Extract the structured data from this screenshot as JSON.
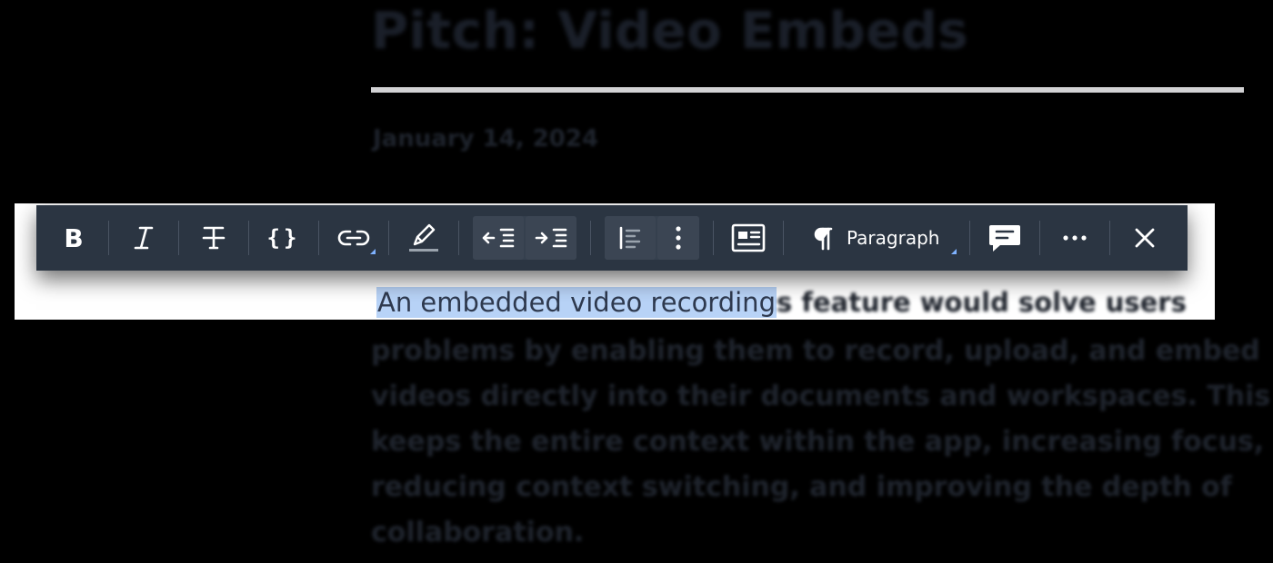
{
  "document": {
    "title": "Pitch: Video Embeds",
    "date": "January 14, 2024",
    "paragraph_line1_selected": "An embedded video recording",
    "paragraph_line1_rest": "s feature would solve users",
    "paragraph_lines": [
      "problems by enabling them to record, upload, and embed",
      "videos directly into their documents and workspaces. This",
      "keeps the entire context within the app, increasing focus,",
      "reducing context switching, and improving the depth of",
      "collaboration."
    ]
  },
  "toolbar": {
    "paragraph_label": "Paragraph",
    "buttons": [
      {
        "name": "bold",
        "icon": "bold-icon"
      },
      {
        "name": "italic",
        "icon": "italic-icon"
      },
      {
        "name": "strikethrough",
        "icon": "strikethrough-icon"
      },
      {
        "name": "code",
        "icon": "code-braces-icon"
      },
      {
        "name": "link",
        "icon": "link-icon"
      },
      {
        "name": "highlight",
        "icon": "highlighter-icon"
      },
      {
        "name": "outdent",
        "icon": "outdent-icon"
      },
      {
        "name": "indent",
        "icon": "indent-icon"
      },
      {
        "name": "align",
        "icon": "align-left-icon"
      },
      {
        "name": "more-vertical",
        "icon": "kebab-vertical-icon"
      },
      {
        "name": "embed",
        "icon": "embed-card-icon"
      },
      {
        "name": "paragraph",
        "icon": "pilcrow-icon"
      },
      {
        "name": "comment",
        "icon": "comment-icon"
      },
      {
        "name": "more",
        "icon": "ellipsis-icon"
      },
      {
        "name": "close",
        "icon": "close-icon"
      }
    ]
  },
  "colors": {
    "toolbar_bg": "#2b3542",
    "selection": "#b8d3f7",
    "caret_accent": "#7fb2ff",
    "icon": "#ffffff"
  }
}
